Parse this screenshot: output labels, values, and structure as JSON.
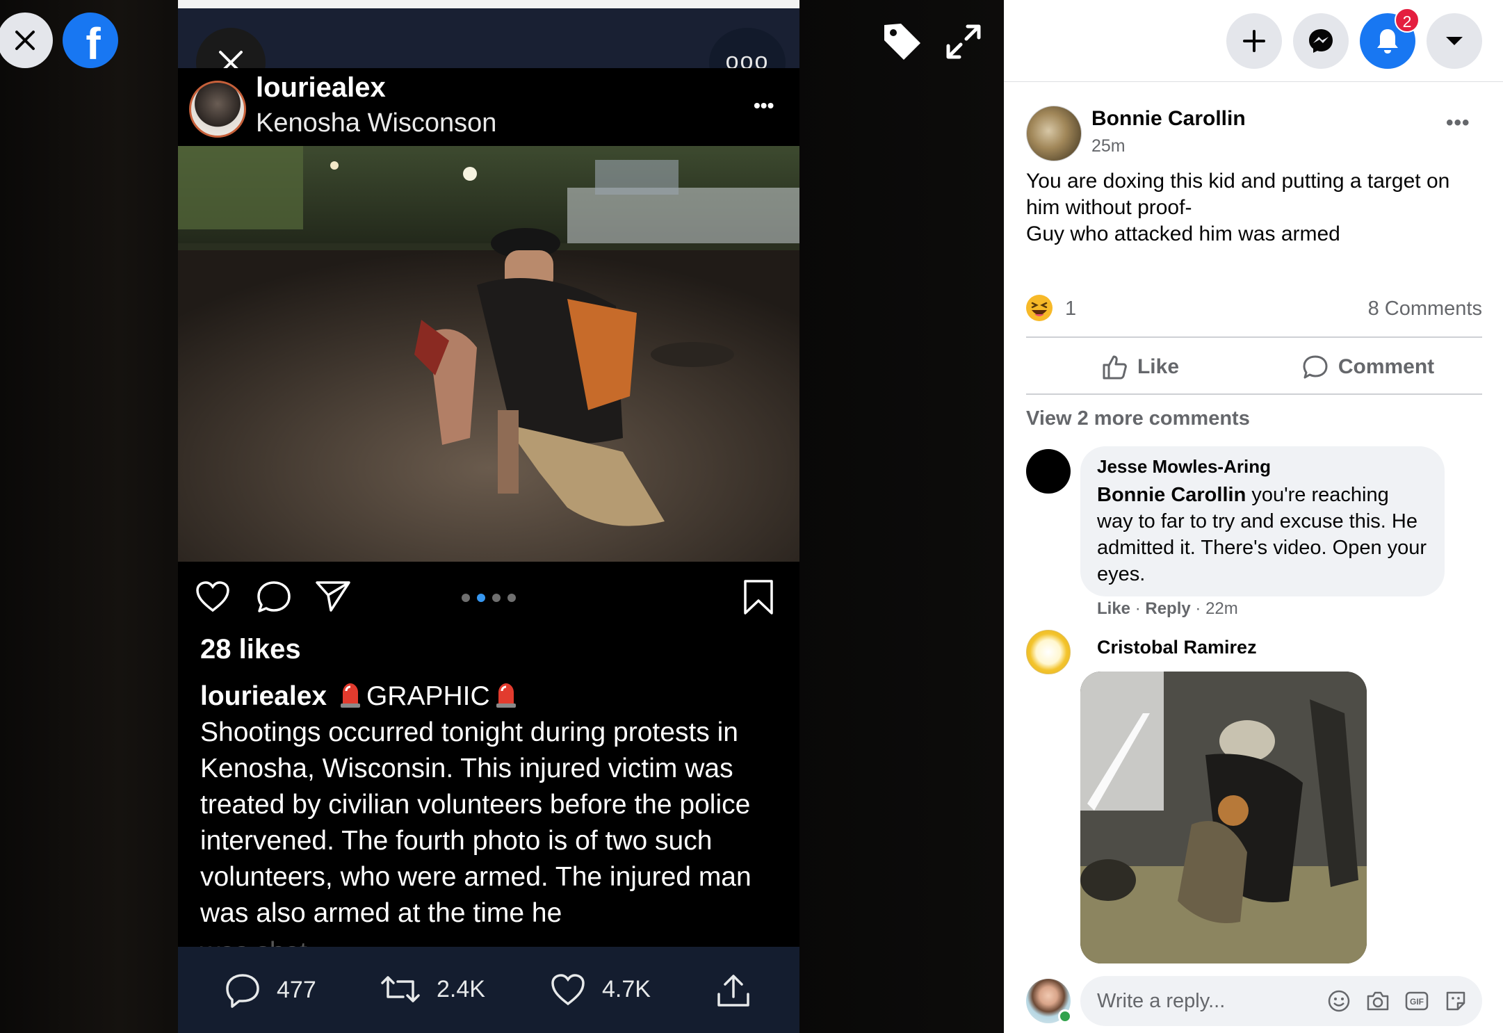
{
  "viewer": {
    "close_label": "Close",
    "logo_letter": "f"
  },
  "instagram": {
    "username": "louriealex",
    "location": "Kenosha Wisconson",
    "likes": "28 likes",
    "caption_user": "louriealex",
    "caption_tag": "GRAPHIC",
    "caption_text": "Shootings occurred tonight during protests in Kenosha, Wisconsin. This injured victim was treated by civilian volunteers before the police intervened. The fourth photo is of two such volunteers, who were armed. The injured man was also armed at the time he",
    "caption_cut": "was shot.",
    "carousel_total": 4,
    "carousel_active": 2
  },
  "twitter": {
    "replies": "477",
    "retweets": "2.4K",
    "likes": "4.7K"
  },
  "topbar": {
    "notifications_count": "2"
  },
  "post": {
    "author": "Bonnie Carollin",
    "time": "25m",
    "text": "You are doxing this kid and putting a target on him without proof-\nGuy who attacked him was armed",
    "reaction_count": "1",
    "comments_count": "8 Comments",
    "like_label": "Like",
    "comment_label": "Comment"
  },
  "comments": {
    "view_more": "View 2 more comments",
    "items": [
      {
        "author": "Jesse Mowles-Aring",
        "mention": "Bonnie Carollin",
        "text": " you're reaching way to far to try and excuse this. He admitted it. There's video. Open your eyes.",
        "like": "Like",
        "reply": "Reply",
        "time": "22m"
      },
      {
        "author": "Cristobal Ramirez"
      }
    ]
  },
  "reply_box": {
    "placeholder": "Write a reply..."
  },
  "colors": {
    "brand": "#1877f2",
    "notification": "#e41e3f",
    "twitter_bar": "#141d2f"
  }
}
